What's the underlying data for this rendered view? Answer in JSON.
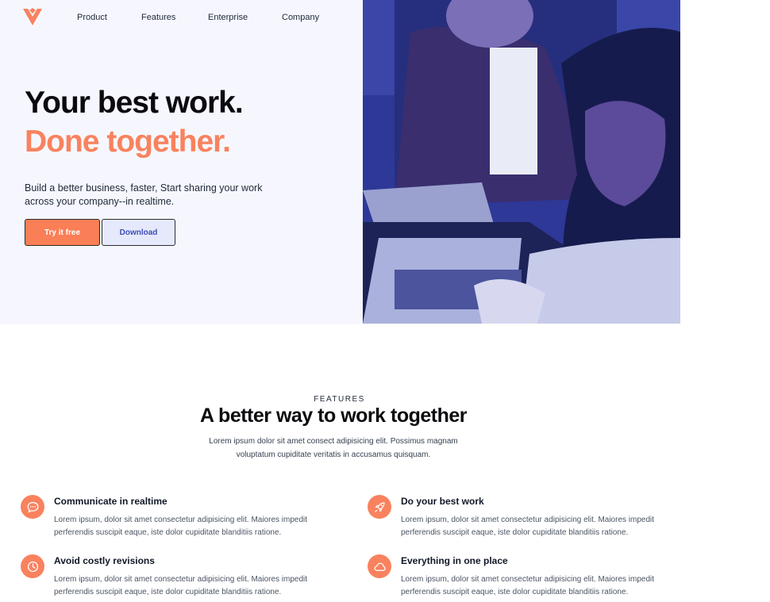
{
  "brand": {
    "logo_icon": "chevron-logo-icon",
    "accent_color": "#f9825e"
  },
  "nav": {
    "items": [
      "Product",
      "Features",
      "Enterprise",
      "Company"
    ]
  },
  "hero": {
    "headline_line1": "Your best work.",
    "headline_line2": "Done together.",
    "description": "Build a better business, faster, Start sharing your work across your company--in realtime.",
    "primary_cta": "Try it free",
    "secondary_cta": "Download",
    "image_alt": "team-working-photo"
  },
  "features": {
    "eyebrow": "FEATURES",
    "title": "A better way to work together",
    "description": "Lorem ipsum dolor sit amet consect adipisicing elit. Possimus magnam voluptatum cupiditate veritatis in accusamus quisquam.",
    "items": [
      {
        "icon": "chat-bubble-icon",
        "title": "Communicate in realtime",
        "description": "Lorem ipsum, dolor sit amet consectetur adipisicing elit. Maiores impedit perferendis suscipit eaque, iste dolor cupiditate blanditiis ratione."
      },
      {
        "icon": "rocket-icon",
        "title": "Do your best work",
        "description": "Lorem ipsum, dolor sit amet consectetur adipisicing elit. Maiores impedit perferendis suscipit eaque, iste dolor cupiditate blanditiis ratione."
      },
      {
        "icon": "clock-icon",
        "title": "Avoid costly revisions",
        "description": "Lorem ipsum, dolor sit amet consectetur adipisicing elit. Maiores impedit perferendis suscipit eaque, iste dolor cupiditate blanditiis ratione."
      },
      {
        "icon": "cloud-icon",
        "title": "Everything in one place",
        "description": "Lorem ipsum, dolor sit amet consectetur adipisicing elit. Maiores impedit perferendis suscipit eaque, iste dolor cupiditate blanditiis ratione."
      }
    ]
  }
}
